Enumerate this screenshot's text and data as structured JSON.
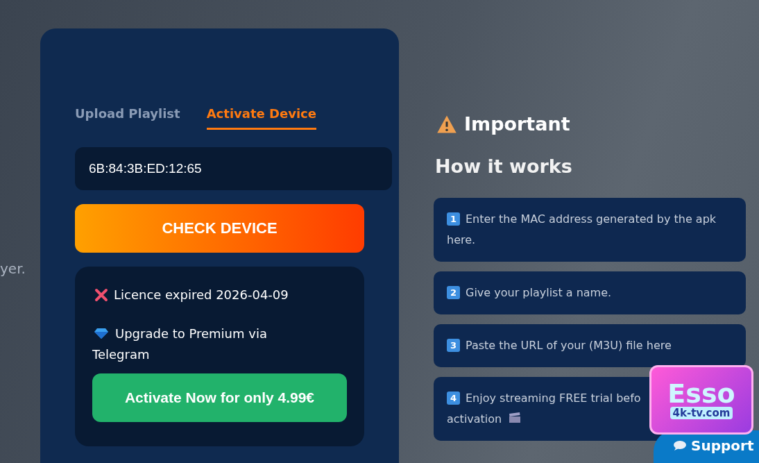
{
  "background_text": "yer.",
  "tabs": [
    {
      "label": "Upload Playlist",
      "selected": false
    },
    {
      "label": "Activate Device",
      "selected": true
    }
  ],
  "mac_field": {
    "value": "6B:84:3B:ED:12:65"
  },
  "check_button": "CHECK DEVICE",
  "status": {
    "licence": "Licence expired 2026-04-09",
    "upgrade": "Upgrade to Premium via Telegram",
    "button": "Activate Now for only 4.99€"
  },
  "important_title": "Important",
  "how_title": "How it works",
  "steps": [
    {
      "number": "1",
      "lines": [
        "Enter the MAC address generated by the apk here."
      ]
    },
    {
      "number": "2",
      "lines": [
        "Give your playlist a name."
      ]
    },
    {
      "number": "3",
      "lines": [
        "Paste the URL of your (M3U) file here"
      ]
    },
    {
      "number": "4",
      "lines": [
        "Enjoy streaming FREE trial befo",
        "activation"
      ]
    }
  ],
  "logo": {
    "title": "Esso",
    "subtitle": "4k-tv.com"
  },
  "support_button": "Support"
}
